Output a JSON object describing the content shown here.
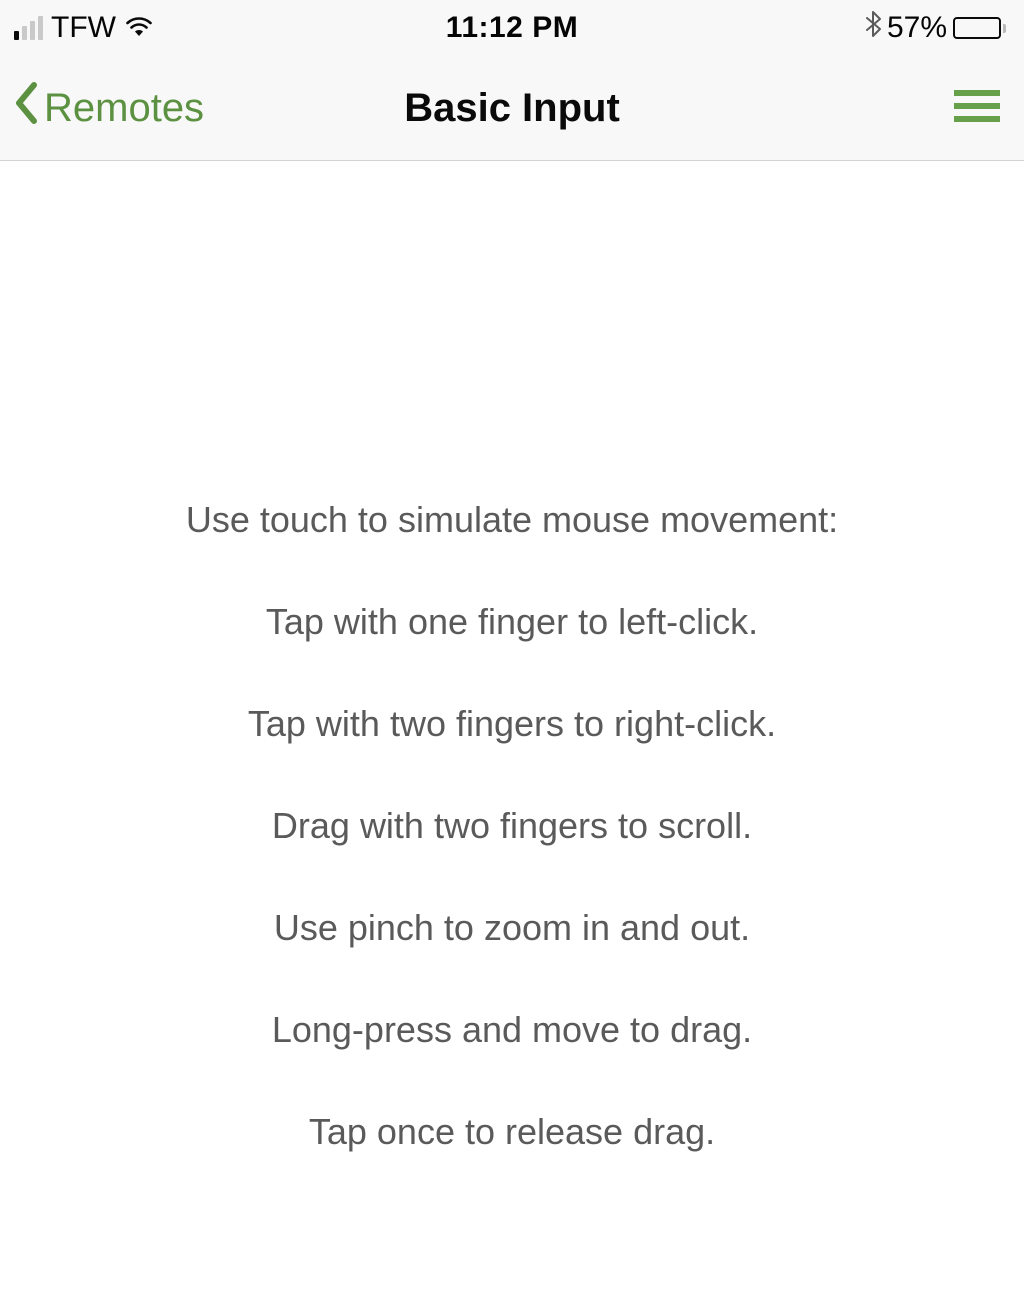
{
  "status": {
    "carrier": "TFW",
    "time": "11:12 PM",
    "battery_pct": "57%"
  },
  "nav": {
    "back_label": "Remotes",
    "title": "Basic Input"
  },
  "instructions": {
    "heading": "Use touch to simulate mouse movement:",
    "lines": [
      "Tap with one finger to left-click.",
      "Tap with two fingers to right-click.",
      "Drag with two fingers to scroll.",
      "Use pinch to zoom in and out.",
      "Long-press and move to drag.",
      "Tap once to release drag."
    ]
  }
}
